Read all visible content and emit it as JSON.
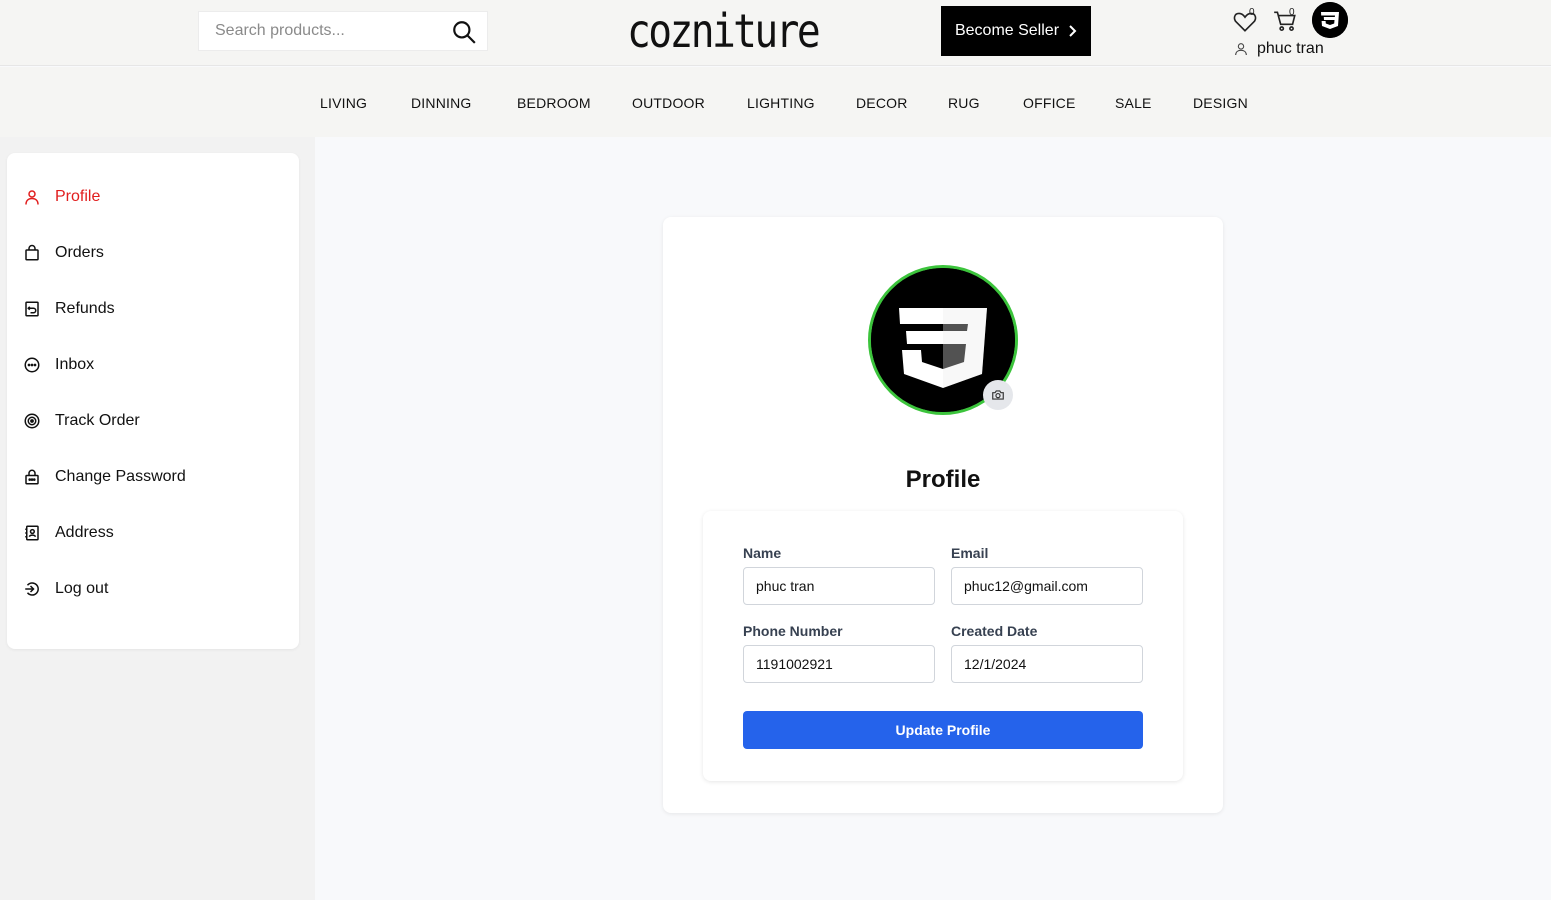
{
  "header": {
    "search_placeholder": "Search products...",
    "logo": "cozniture",
    "become_seller": "Become Seller",
    "wishlist_count": "0",
    "cart_count": "0",
    "username": "phuc tran"
  },
  "nav": {
    "items": [
      "LIVING",
      "DINNING",
      "BEDROOM",
      "OUTDOOR",
      "LIGHTING",
      "DECOR",
      "RUG",
      "OFFICE",
      "SALE",
      "DESIGN"
    ]
  },
  "sidebar": {
    "items": [
      {
        "label": "Profile",
        "icon": "user-icon",
        "active": true
      },
      {
        "label": "Orders",
        "icon": "bag-icon"
      },
      {
        "label": "Refunds",
        "icon": "refund-icon"
      },
      {
        "label": "Inbox",
        "icon": "chat-icon"
      },
      {
        "label": "Track Order",
        "icon": "track-icon"
      },
      {
        "label": "Change Password",
        "icon": "lock-icon"
      },
      {
        "label": "Address",
        "icon": "address-book-icon"
      },
      {
        "label": "Log out",
        "icon": "logout-icon"
      }
    ],
    "active_color": "#e11d1d"
  },
  "profile": {
    "title": "Profile",
    "name_label": "Name",
    "name_value": "phuc tran",
    "email_label": "Email",
    "email_value": "phuc12@gmail.com",
    "phone_label": "Phone Number",
    "phone_value": "1191002921",
    "created_label": "Created Date",
    "created_value": "12/1/2024",
    "update_button": "Update Profile",
    "button_color": "#2563eb",
    "avatar_ring_color": "#3cc43c"
  }
}
